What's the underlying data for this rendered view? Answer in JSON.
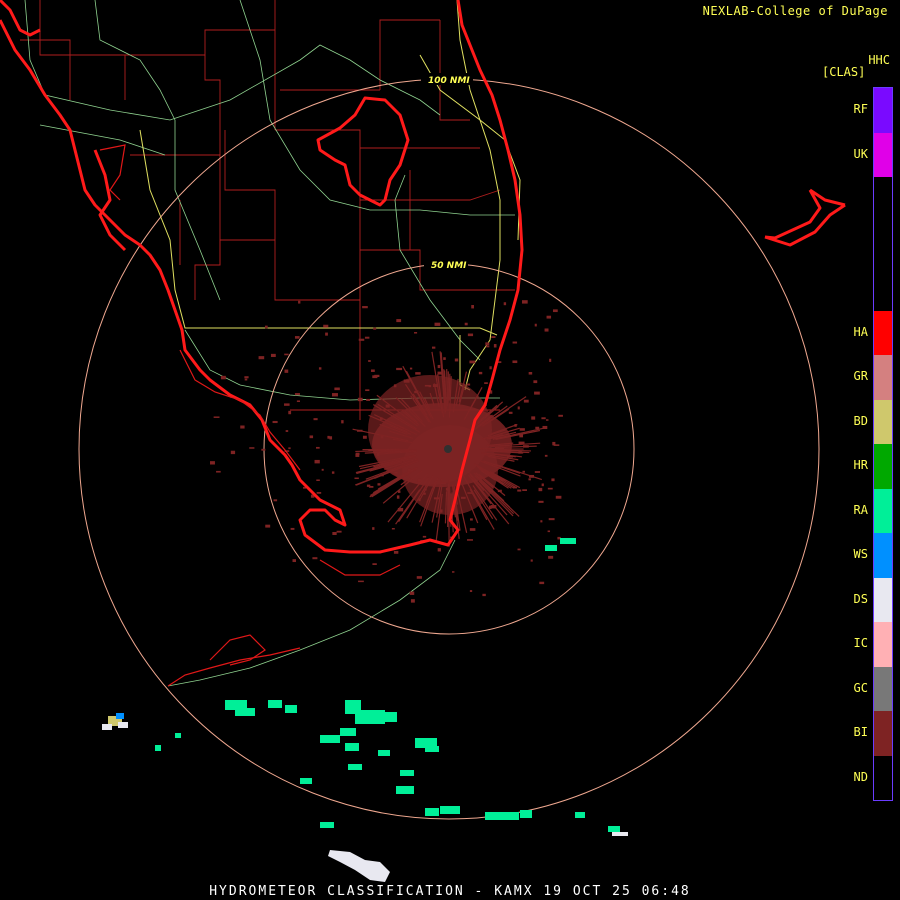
{
  "credit": "NEXLAB-College of DuPage",
  "legend": {
    "title_top": "HHC",
    "title_bottom": "[CLAS]",
    "classes": [
      {
        "code": "RF",
        "color": "#7a0aff"
      },
      {
        "code": "UK",
        "color": "#e000e8"
      },
      {
        "code": "",
        "color": "#000000"
      },
      {
        "code": "",
        "color": "#000000"
      },
      {
        "code": "",
        "color": "#000000"
      },
      {
        "code": "HA",
        "color": "#ff0000"
      },
      {
        "code": "GR",
        "color": "#d48080"
      },
      {
        "code": "BD",
        "color": "#cfc86c"
      },
      {
        "code": "HR",
        "color": "#00a800"
      },
      {
        "code": "RA",
        "color": "#00ef98"
      },
      {
        "code": "WS",
        "color": "#0090ff"
      },
      {
        "code": "DS",
        "color": "#e8e8f0"
      },
      {
        "code": "IC",
        "color": "#ffb0b4"
      },
      {
        "code": "GC",
        "color": "#787878"
      },
      {
        "code": "BI",
        "color": "#7e2323"
      },
      {
        "code": "ND",
        "color": "#000000"
      }
    ]
  },
  "rings": [
    {
      "label": "50 NMI",
      "range_nmi": 50
    },
    {
      "label": "100 NMI",
      "range_nmi": 100
    }
  ],
  "footer": "HYDROMETEOR CLASSIFICATION - KAMX 19 OCT 25 06:48"
}
